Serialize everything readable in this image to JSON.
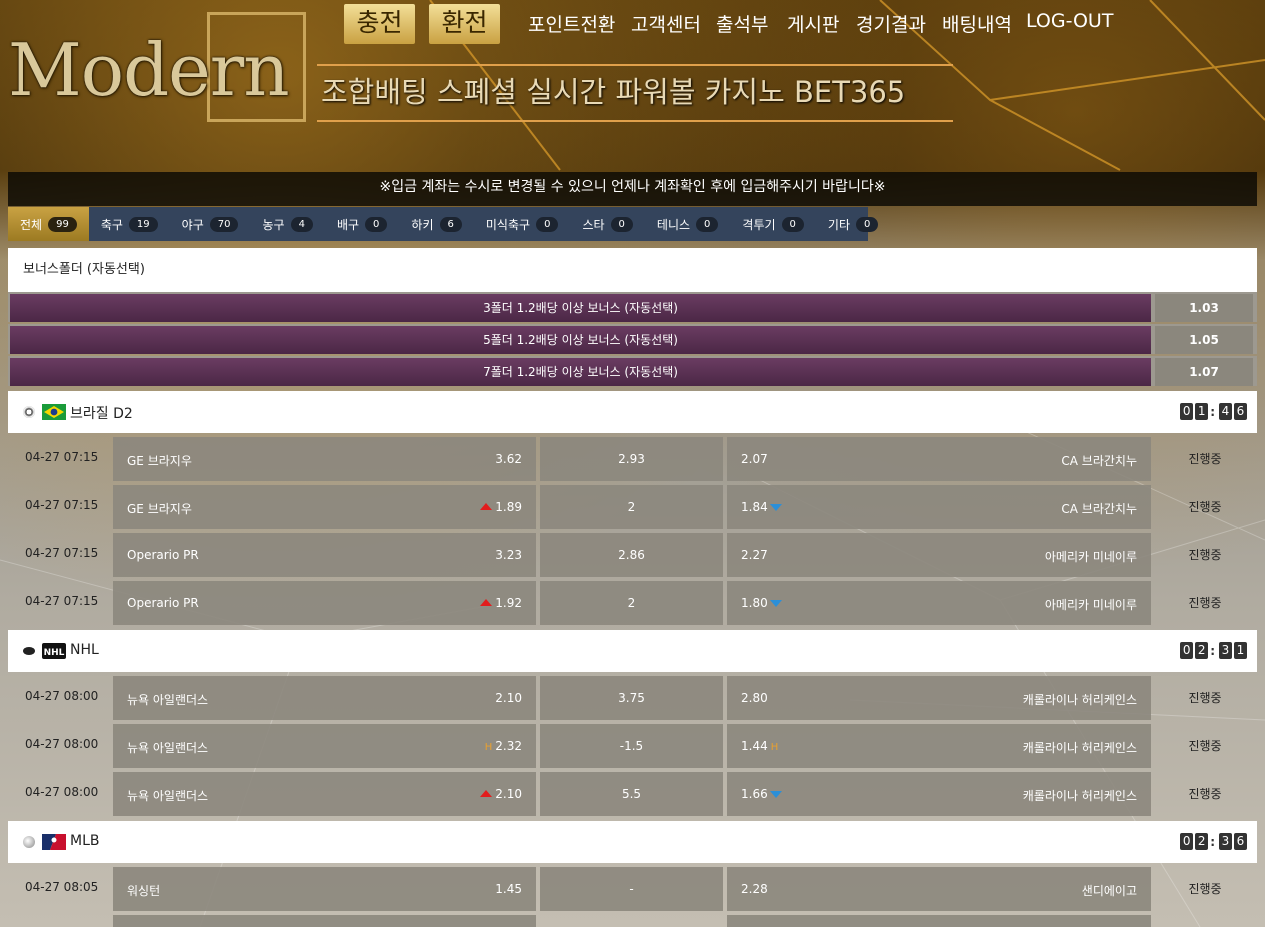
{
  "header": {
    "logo": "Modern",
    "deposit_label": "충전",
    "withdraw_label": "환전",
    "nav": [
      "포인트전환",
      "고객센터",
      "출석부",
      "게시판",
      "경기결과",
      "배팅내역",
      "LOG-OUT"
    ],
    "banner": "조합배팅 스폐셜 실시간 파워볼 카지노 BET365"
  },
  "notice": "※입금 계좌는 수시로 변경될 수 있으니 언제나 계좌확인 후에 입금해주시기 바랍니다※",
  "tabs": [
    {
      "label": "전체",
      "count": "99"
    },
    {
      "label": "축구",
      "count": "19"
    },
    {
      "label": "야구",
      "count": "70"
    },
    {
      "label": "농구",
      "count": "4"
    },
    {
      "label": "배구",
      "count": "0"
    },
    {
      "label": "하키",
      "count": "6"
    },
    {
      "label": "미식축구",
      "count": "0"
    },
    {
      "label": "스타",
      "count": "0"
    },
    {
      "label": "테니스",
      "count": "0"
    },
    {
      "label": "격투기",
      "count": "0"
    },
    {
      "label": "기타",
      "count": "0"
    }
  ],
  "bonus": {
    "title": "보너스폴더 (자동선택)",
    "items": [
      {
        "label": "3폴더 1.2배당 이상 보너스 (자동선택)",
        "odds": "1.03"
      },
      {
        "label": "5폴더 1.2배당 이상 보너스 (자동선택)",
        "odds": "1.05"
      },
      {
        "label": "7폴더 1.2배당 이상 보너스 (자동선택)",
        "odds": "1.07"
      }
    ]
  },
  "leagues": [
    {
      "name": "브라질 D2",
      "timer": [
        "0",
        "1",
        "4",
        "6"
      ],
      "games": [
        {
          "time": "04-27 07:15",
          "home": "GE 브라지우",
          "home_odd": "3.62",
          "mid": "2.93",
          "away_odd": "2.07",
          "away": "CA 브라간치누",
          "status": "진행중",
          "home_mark": "",
          "away_mark": ""
        },
        {
          "time": "04-27 07:15",
          "home": "GE 브라지우",
          "home_odd": "1.89",
          "mid": "2",
          "away_odd": "1.84",
          "away": "CA 브라간치누",
          "status": "진행중",
          "home_mark": "up",
          "away_mark": "down"
        },
        {
          "time": "04-27 07:15",
          "home": "Operario PR",
          "home_odd": "3.23",
          "mid": "2.86",
          "away_odd": "2.27",
          "away": "아메리카 미네이루",
          "status": "진행중",
          "home_mark": "",
          "away_mark": ""
        },
        {
          "time": "04-27 07:15",
          "home": "Operario PR",
          "home_odd": "1.92",
          "mid": "2",
          "away_odd": "1.80",
          "away": "아메리카 미네이루",
          "status": "진행중",
          "home_mark": "up",
          "away_mark": "down"
        }
      ]
    },
    {
      "name": "NHL",
      "timer": [
        "0",
        "2",
        "3",
        "1"
      ],
      "games": [
        {
          "time": "04-27 08:00",
          "home": "뉴욕 아일랜더스",
          "home_odd": "2.10",
          "mid": "3.75",
          "away_odd": "2.80",
          "away": "캐롤라이나 허리케인스",
          "status": "진행중",
          "home_mark": "",
          "away_mark": ""
        },
        {
          "time": "04-27 08:00",
          "home": "뉴욕 아일랜더스",
          "home_odd": "2.32",
          "mid": "-1.5",
          "away_odd": "1.44",
          "away": "캐롤라이나 허리케인스",
          "status": "진행중",
          "home_mark": "H",
          "away_mark": "H"
        },
        {
          "time": "04-27 08:00",
          "home": "뉴욕 아일랜더스",
          "home_odd": "2.10",
          "mid": "5.5",
          "away_odd": "1.66",
          "away": "캐롤라이나 허리케인스",
          "status": "진행중",
          "home_mark": "up",
          "away_mark": "down"
        }
      ]
    },
    {
      "name": "MLB",
      "timer": [
        "0",
        "2",
        "3",
        "6"
      ],
      "games": [
        {
          "time": "04-27 08:05",
          "home": "워싱턴",
          "home_odd": "1.45",
          "mid": "-",
          "away_odd": "2.28",
          "away": "샌디에이고",
          "status": "진행중",
          "home_mark": "",
          "away_mark": ""
        }
      ]
    }
  ],
  "colors": {
    "gold": "#c9a243",
    "bonus_purple": "#5a3152",
    "tab_bar": "#34445c",
    "up_arrow": "#e21d1d",
    "down_arrow": "#2b8fd8"
  }
}
